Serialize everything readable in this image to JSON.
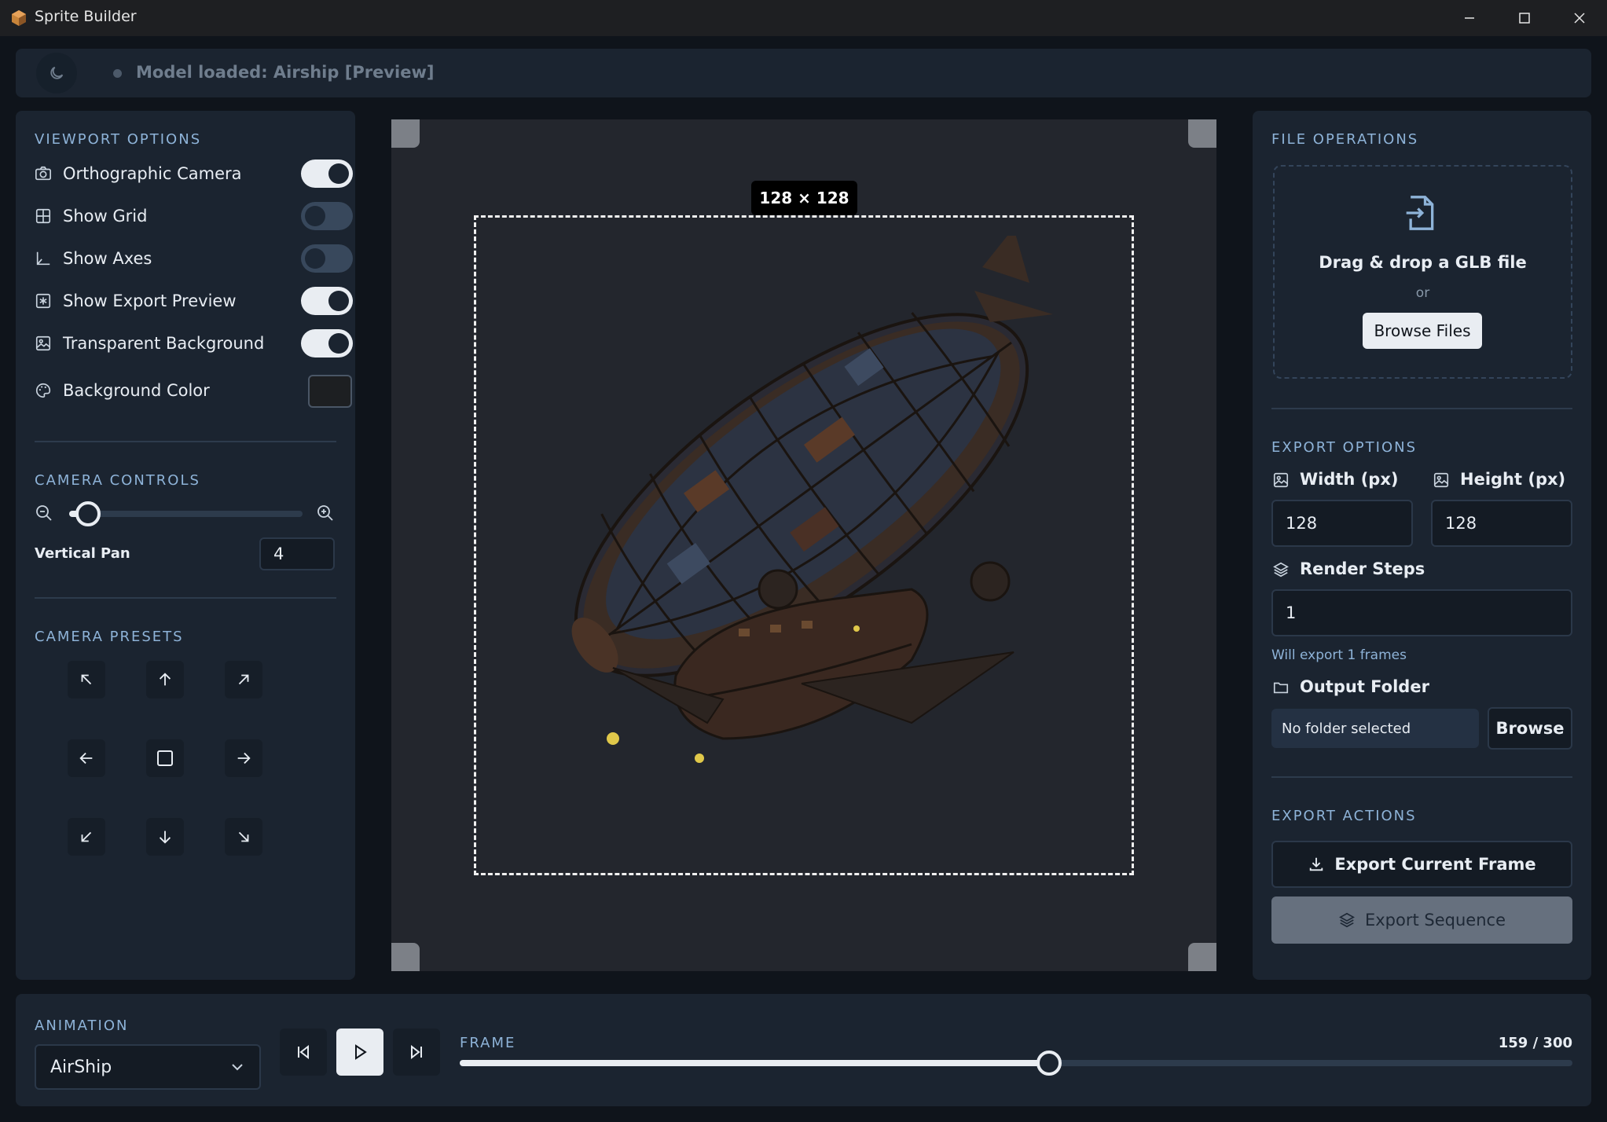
{
  "window": {
    "title": "Sprite Builder"
  },
  "status": {
    "text": "Model loaded: Airship [Preview]"
  },
  "viewport_options": {
    "title": "VIEWPORT OPTIONS",
    "items": [
      {
        "label": "Orthographic Camera",
        "icon": "camera-icon",
        "on": true
      },
      {
        "label": "Show Grid",
        "icon": "grid-icon",
        "on": false
      },
      {
        "label": "Show Axes",
        "icon": "axes-icon",
        "on": false
      },
      {
        "label": "Show Export Preview",
        "icon": "export-preview-icon",
        "on": true
      },
      {
        "label": "Transparent Background",
        "icon": "image-icon",
        "on": true
      }
    ],
    "background_color": {
      "label": "Background Color",
      "value": "#1d1f22"
    }
  },
  "camera_controls": {
    "title": "CAMERA CONTROLS",
    "zoom_level": 0.08,
    "vertical_pan": {
      "label": "Vertical Pan",
      "value": "4"
    }
  },
  "camera_presets": {
    "title": "CAMERA PRESETS",
    "buttons": [
      "up-left",
      "up",
      "up-right",
      "left",
      "center",
      "right",
      "down-left",
      "down",
      "down-right"
    ]
  },
  "viewport": {
    "dimensions_label": "128 × 128"
  },
  "file_operations": {
    "title": "FILE OPERATIONS",
    "drop_text": "Drag & drop a GLB file",
    "or_text": "or",
    "browse_label": "Browse Files"
  },
  "export_options": {
    "title": "EXPORT OPTIONS",
    "width_label": "Width (px)",
    "width_value": "128",
    "height_label": "Height (px)",
    "height_value": "128",
    "render_steps_label": "Render Steps",
    "render_steps_value": "1",
    "frames_hint": "Will export 1 frames",
    "output_folder_label": "Output Folder",
    "output_folder_value": "No folder selected",
    "browse_label": "Browse"
  },
  "export_actions": {
    "title": "EXPORT ACTIONS",
    "export_frame_label": "Export Current Frame",
    "export_sequence_label": "Export Sequence"
  },
  "animation": {
    "title": "ANIMATION",
    "selected": "AirShip",
    "frame_title": "FRAME",
    "frame_counter": "159 / 300",
    "current_frame": 159,
    "total_frames": 300
  },
  "colors": {
    "accent": "#8eb3d8",
    "panel": "#1b2430",
    "background": "#0f141b"
  }
}
